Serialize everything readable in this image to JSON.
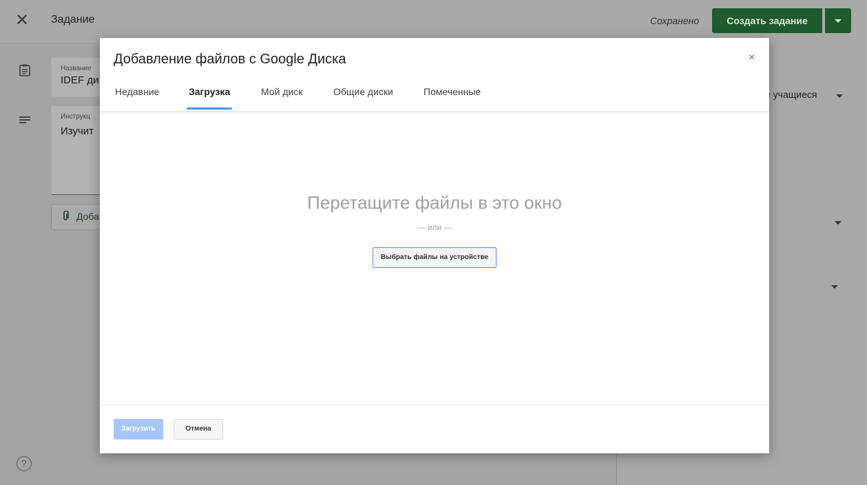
{
  "topbar": {
    "title": "Задание",
    "saved_status": "Сохранено",
    "create_button": "Создать задание"
  },
  "form": {
    "title_label": "Название",
    "title_value": "IDEF ди",
    "instructions_label": "Инструкц",
    "instructions_value": "Изучит",
    "attach_label": "Доба"
  },
  "right_panel": {
    "students_select": "е учащиеся"
  },
  "dialog": {
    "title": "Добавление файлов с Google Диска",
    "close_symbol": "×",
    "tabs": [
      {
        "label": "Недавние"
      },
      {
        "label": "Загрузка"
      },
      {
        "label": "Мой диск"
      },
      {
        "label": "Общие диски"
      },
      {
        "label": "Помеченные"
      }
    ],
    "active_tab": "Загрузка",
    "drop_text": "Перетащите файлы в это окно",
    "or_text": "— или —",
    "choose_files_button": "Выбрать файлы на устройстве",
    "upload_button": "Загрузить",
    "cancel_button": "Отмена"
  },
  "colors": {
    "accent_blue": "#4d90fe",
    "create_green": "#1e5a2c",
    "disabled_blue": "#a8c6fa"
  },
  "icons": {
    "close": "close-icon",
    "assignment": "assignment-icon",
    "instructions": "notes-icon",
    "attach": "paperclip-icon",
    "help": "help-icon",
    "dropdown": "chevron-down-icon"
  }
}
